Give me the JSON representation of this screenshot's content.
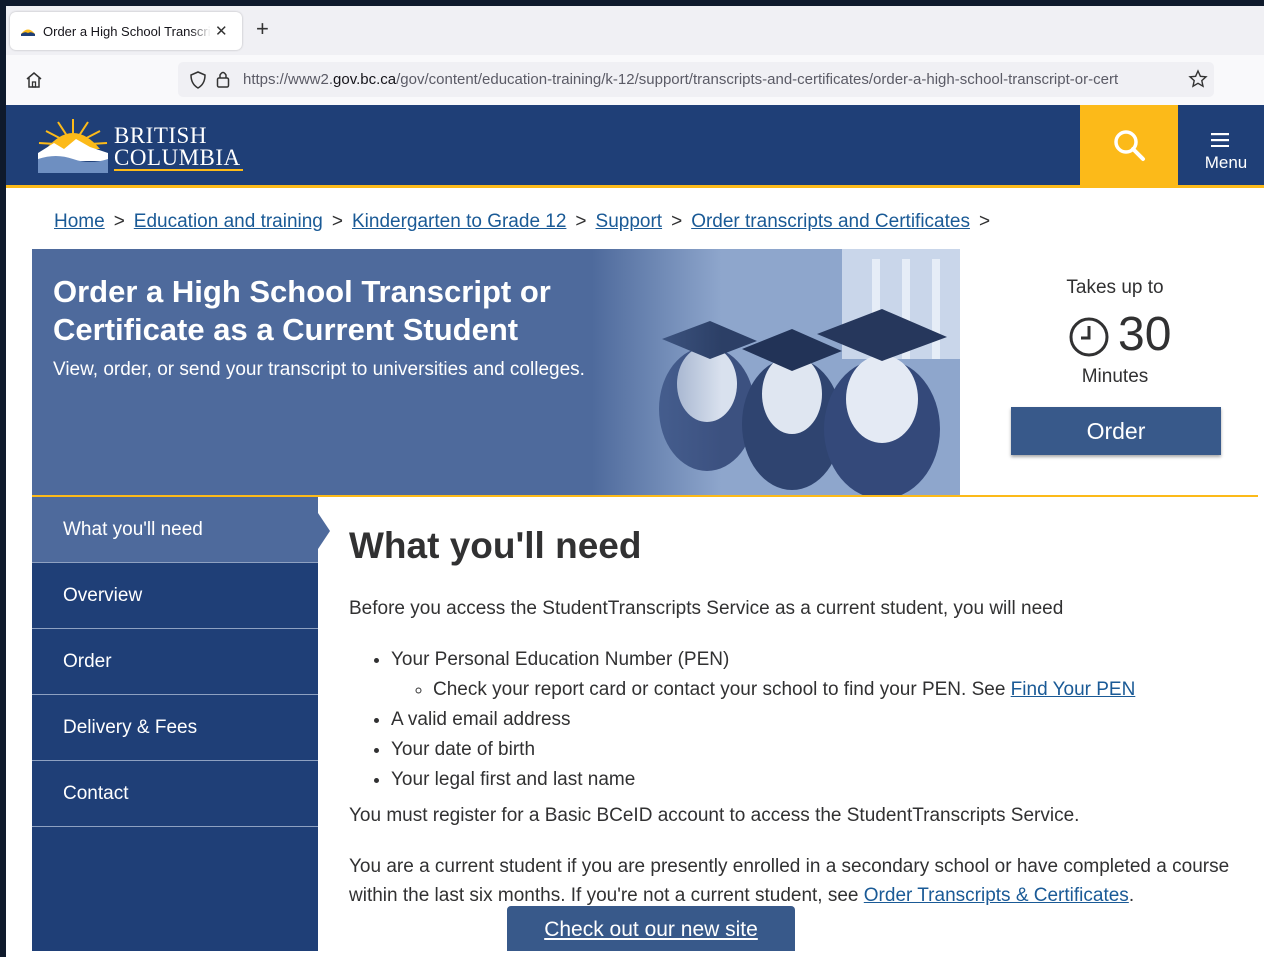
{
  "browser": {
    "tab_title": "Order a High School Transcript o",
    "tab_close": "✕",
    "new_tab": "+",
    "url_prefix": "https://www2.",
    "url_domain": "gov.bc.ca",
    "url_path": "/gov/content/education-training/k-12/support/transcripts-and-certificates/order-a-high-school-transcript-or-cert"
  },
  "header": {
    "logo_line1": "BRITISH",
    "logo_line2": "COLUMBIA",
    "menu_label": "Menu",
    "colors": {
      "navy": "#1f3f77",
      "gold": "#fcba19"
    }
  },
  "breadcrumb": {
    "items": [
      "Home",
      "Education and training",
      "Kindergarten to Grade 12",
      "Support",
      "Order transcripts and Certificates"
    ],
    "separator": ">"
  },
  "hero": {
    "title": "Order a High School Transcript or Certificate as a Current Student",
    "subtitle": "View, order, or send your transcript to universities and colleges."
  },
  "takes": {
    "label": "Takes up to",
    "value": "30",
    "unit": "Minutes",
    "order_button": "Order"
  },
  "sidebar": {
    "items": [
      "What you'll need",
      "Overview",
      "Order",
      "Delivery & Fees",
      "Contact"
    ],
    "active_index": 0
  },
  "content": {
    "heading": "What you'll need",
    "intro": "Before you access the StudentTranscripts Service as a current student, you will need",
    "bullet1": "Your Personal Education Number (PEN)",
    "sub_bullet_text": "Check your report card or contact your school to find your PEN. See ",
    "sub_bullet_link": "Find Your PEN",
    "bullet2": "A valid email address",
    "bullet3": "Your date of birth",
    "bullet4": "Your legal first and last name",
    "p2": "You must register for a Basic BCeID account to access the StudentTranscripts Service.",
    "p3_text": "You are a current student if you are presently enrolled in a secondary school or have completed a course within the last six months. If you're not a current student, see ",
    "p3_link": "Order Transcripts & Certificates",
    "p3_end": "."
  },
  "new_site_link": "Check out our new site"
}
